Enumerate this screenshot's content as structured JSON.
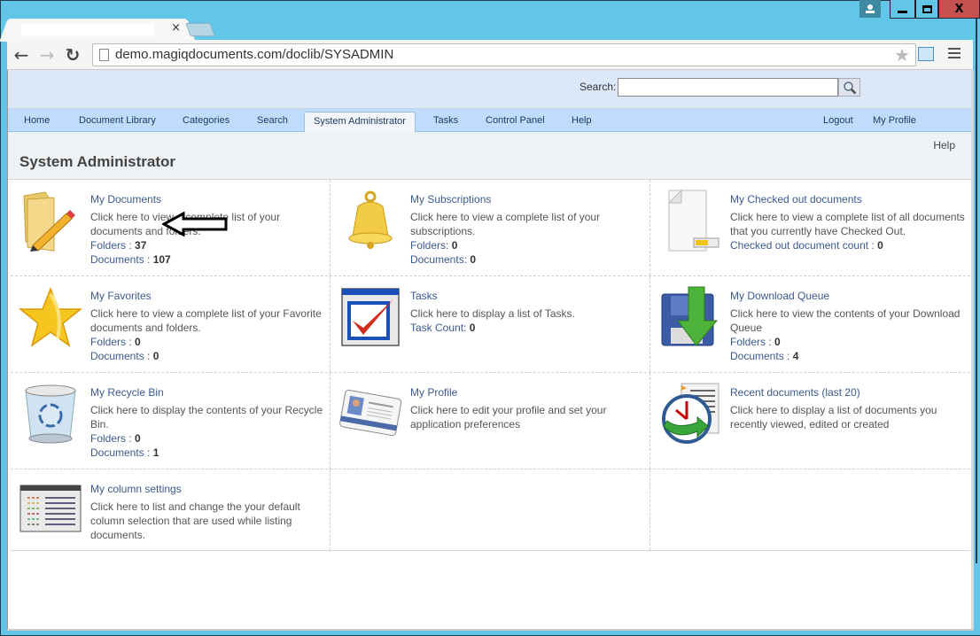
{
  "browser": {
    "url": "demo.magiqdocuments.com/doclib/SYSADMIN",
    "tab_close": "×",
    "back_icon": "←",
    "forward_icon": "→",
    "reload_icon": "↻",
    "star_icon": "★",
    "window_controls": {
      "minimize": "—",
      "maximize": "□",
      "close": "X"
    }
  },
  "header": {
    "search_label": "Search:",
    "search_value": "",
    "search_placeholder": ""
  },
  "nav": {
    "items": [
      {
        "label": "Home"
      },
      {
        "label": "Document Library"
      },
      {
        "label": "Categories"
      },
      {
        "label": "Search"
      },
      {
        "label": "System Administrator",
        "active": true
      },
      {
        "label": "Tasks"
      },
      {
        "label": "Control Panel"
      },
      {
        "label": "Help"
      }
    ],
    "right_items": [
      {
        "label": "Logout"
      },
      {
        "label": "My Profile"
      }
    ]
  },
  "page": {
    "title": "System Administrator",
    "help": "Help"
  },
  "tiles": [
    {
      "title": "My Documents",
      "desc": "Click here to view a complete list of your documents and folders.",
      "stats": [
        {
          "label": "Folders : ",
          "value": "37"
        },
        {
          "label": "Documents : ",
          "value": "107"
        }
      ]
    },
    {
      "title": "My Subscriptions",
      "desc": "Click here to view a complete list of your subscriptions.",
      "stats": [
        {
          "label": "Folders: ",
          "value": "0"
        },
        {
          "label": "Documents: ",
          "value": "0"
        }
      ]
    },
    {
      "title": "My Checked out documents",
      "desc": "Click here to view a complete list of all documents that you currently have Checked Out.",
      "stats": [
        {
          "label": "Checked out document count : ",
          "value": "0"
        }
      ]
    },
    {
      "title": "My Favorites",
      "desc": "Click here to view a complete list of your Favorite documents and folders.",
      "stats": [
        {
          "label": "Folders : ",
          "value": "0"
        },
        {
          "label": "Documents : ",
          "value": "0"
        }
      ]
    },
    {
      "title": "Tasks",
      "desc": "Click here to display a list of Tasks.",
      "stats": [
        {
          "label": "Task Count: ",
          "value": "0"
        }
      ]
    },
    {
      "title": "My Download Queue",
      "desc": "Click here to view the contents of your Download Queue",
      "stats": [
        {
          "label": "Folders : ",
          "value": "0"
        },
        {
          "label": "Documents : ",
          "value": "4"
        }
      ]
    },
    {
      "title": "My Recycle Bin",
      "desc": "Click here to display the contents of your Recycle Bin.",
      "stats": [
        {
          "label": "Folders : ",
          "value": "0"
        },
        {
          "label": "Documents : ",
          "value": "1"
        }
      ]
    },
    {
      "title": "My Profile",
      "desc": "Click here to edit your profile and set your application preferences",
      "stats": []
    },
    {
      "title": "Recent documents (last 20)",
      "desc": "Click here to display a list of documents you recently viewed, edited or created",
      "stats": []
    },
    {
      "title": "My column settings",
      "desc": "Click here to list and change the your default column selection that are used while listing documents.",
      "stats": []
    }
  ]
}
